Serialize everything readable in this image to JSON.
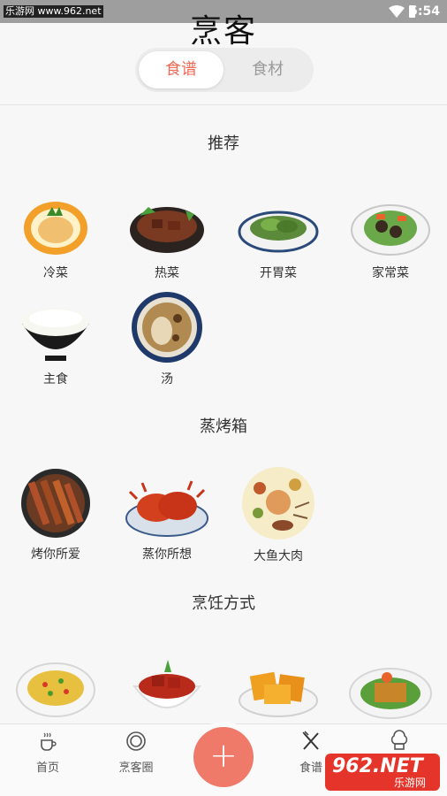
{
  "status_bar": {
    "source": "乐游网 www.962.net",
    "time": "5:54"
  },
  "header": {
    "title": "烹客"
  },
  "segmented": {
    "active": "食谱",
    "inactive": "食材"
  },
  "sections": {
    "recommend": {
      "title": "推荐",
      "items": [
        {
          "label": "冷菜"
        },
        {
          "label": "热菜"
        },
        {
          "label": "开胃菜"
        },
        {
          "label": "家常菜"
        },
        {
          "label": "主食"
        },
        {
          "label": "汤"
        }
      ]
    },
    "oven": {
      "title": "蒸烤箱",
      "items": [
        {
          "label": "烤你所爱"
        },
        {
          "label": "蒸你所想"
        },
        {
          "label": "大鱼大肉"
        }
      ]
    },
    "method": {
      "title": "烹饪方式"
    }
  },
  "tabbar": {
    "home": "首页",
    "circle": "烹客圈",
    "fab": "+",
    "recipes": "食谱"
  },
  "watermark": {
    "big": "962.NET",
    "small": "乐游网"
  },
  "colors": {
    "accent": "#ef6a56",
    "fab": "#f07a6a"
  }
}
